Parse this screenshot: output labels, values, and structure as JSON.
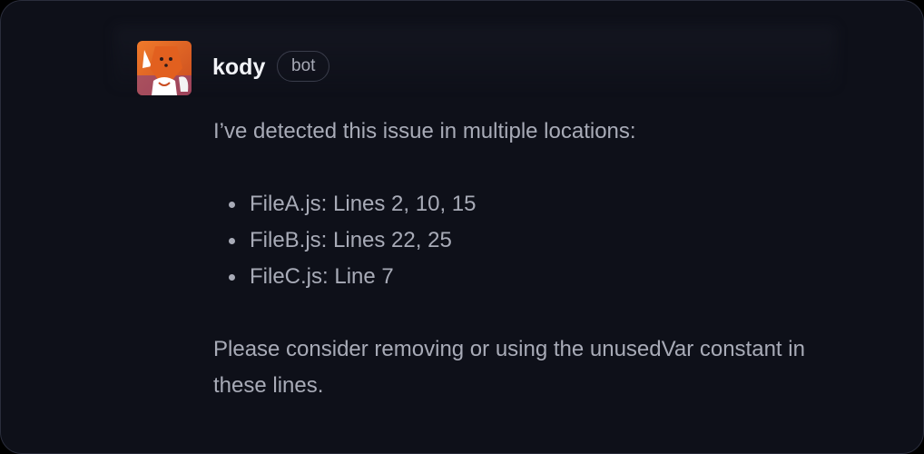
{
  "comment": {
    "author": "kody",
    "badge": "bot",
    "avatar_icon": "fox-mascot-icon",
    "intro": "I’ve detected this issue in multiple locations:",
    "locations": [
      "FileA.js: Lines 2, 10, 15",
      "FileB.js: Lines 22, 25",
      "FileC.js: Line 7"
    ],
    "closing": "Please consider removing or using the unusedVar constant in these lines."
  },
  "colors": {
    "background": "#0e1019",
    "text": "#a8abb7",
    "author": "#f2f3f7",
    "accent": "#e8622a"
  }
}
